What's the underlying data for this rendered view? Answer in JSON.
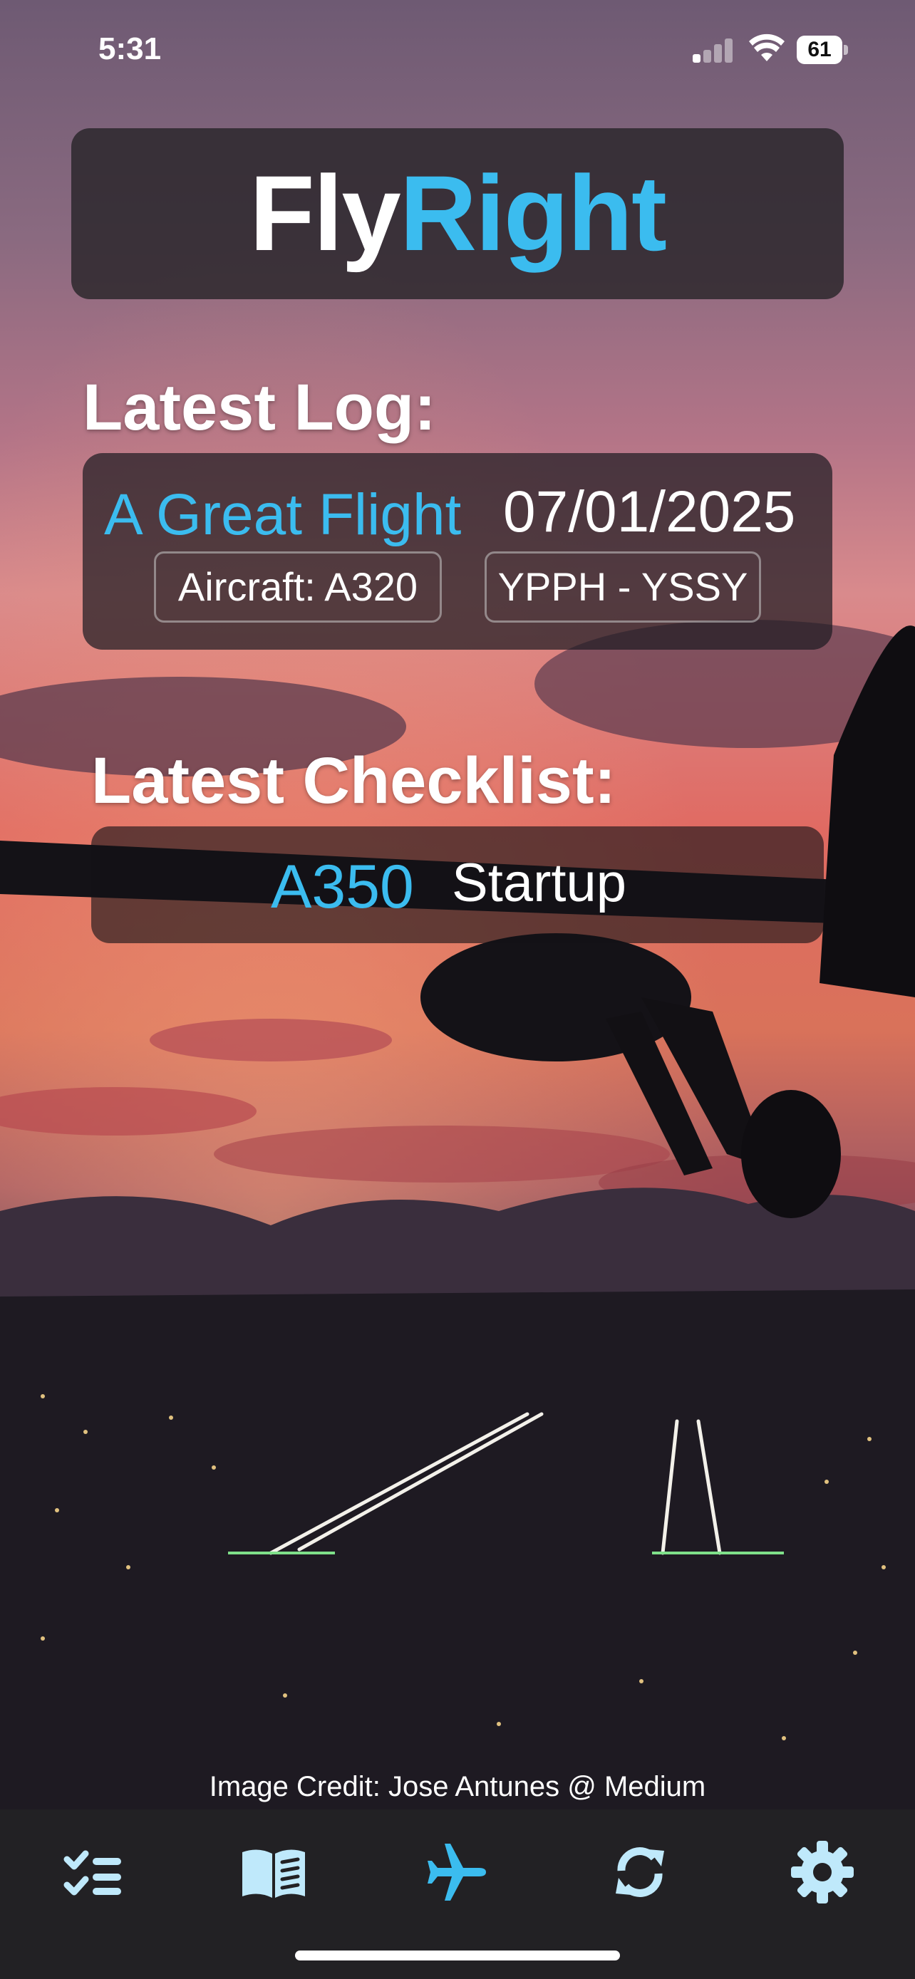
{
  "status_bar": {
    "time": "5:31",
    "battery": "61"
  },
  "app": {
    "title_part1": "Fly",
    "title_part2": "Right",
    "accent_color": "#3bbcef"
  },
  "latest_log": {
    "heading": "Latest Log:",
    "name": "A Great Flight",
    "date": "07/01/2025",
    "aircraft": "Aircraft: A320",
    "route": "YPPH - YSSY"
  },
  "latest_checklist": {
    "heading": "Latest Checklist:",
    "aircraft": "A350",
    "name": "Startup"
  },
  "image_credit": "Image Credit: Jose Antunes @ Medium",
  "tab_bar": {
    "items": [
      {
        "icon": "checklist-icon",
        "active": false
      },
      {
        "icon": "book-icon",
        "active": false
      },
      {
        "icon": "airplane-icon",
        "active": true
      },
      {
        "icon": "sync-icon",
        "active": false
      },
      {
        "icon": "gear-icon",
        "active": false
      }
    ]
  }
}
